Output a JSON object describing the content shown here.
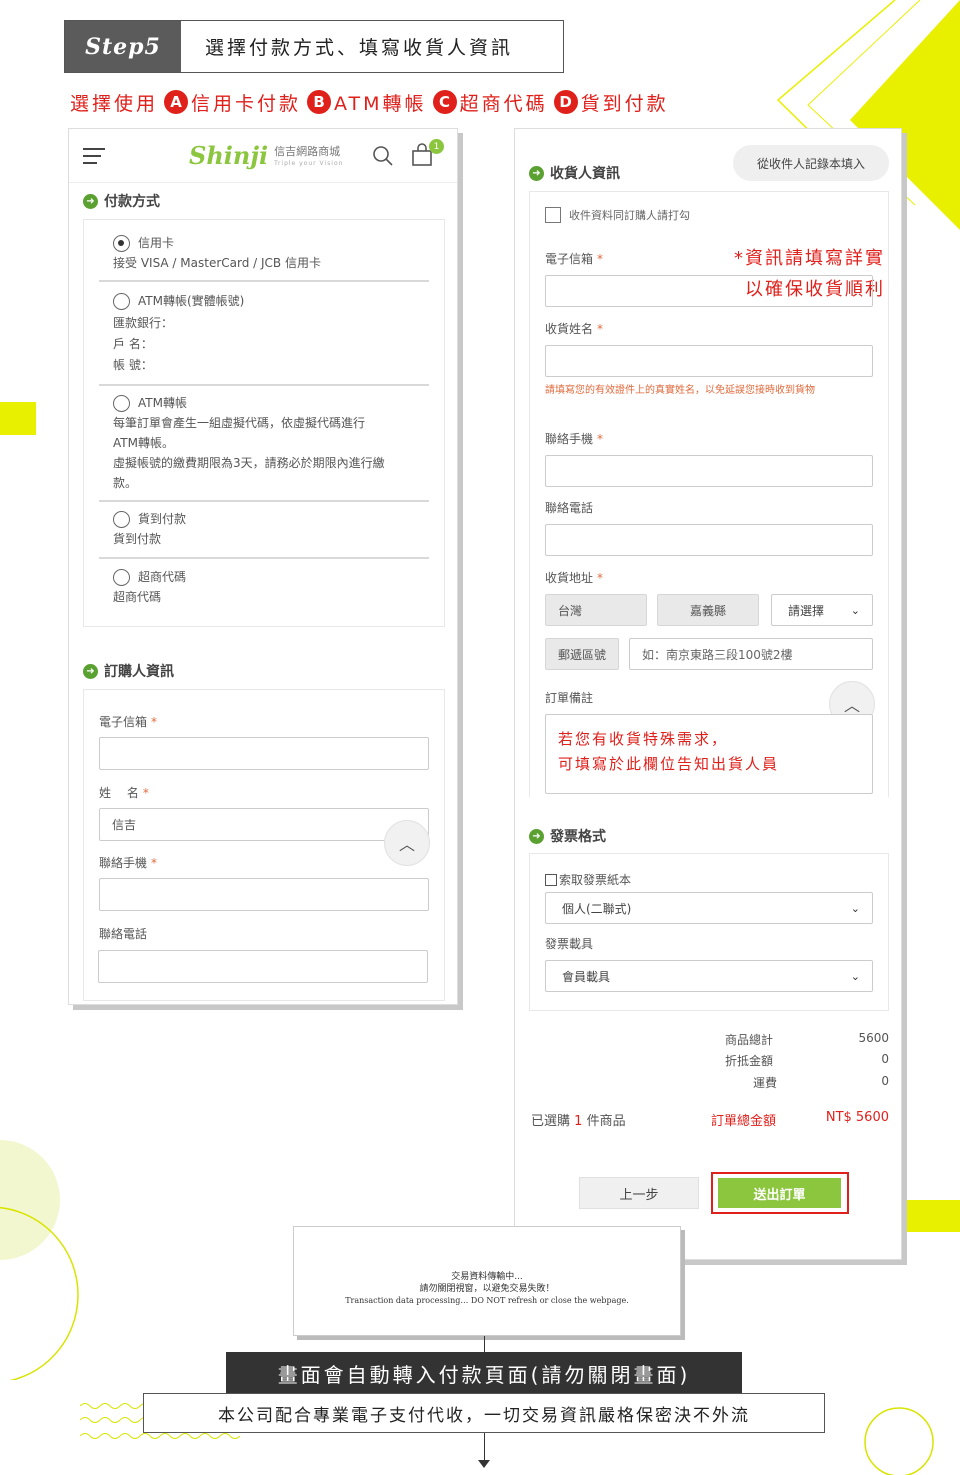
{
  "step": {
    "tag": "Step5",
    "title": "選擇付款方式、填寫收貨人資訊"
  },
  "choose": {
    "prefix": "選擇使用",
    "options": [
      {
        "badge": "A",
        "label": "信用卡付款"
      },
      {
        "badge": "B",
        "label": "ATM轉帳"
      },
      {
        "badge": "C",
        "label": "超商代碼"
      },
      {
        "badge": "D",
        "label": "貨到付款"
      }
    ]
  },
  "left": {
    "header": {
      "logo": "Shinji",
      "logo_cn": "信吉網路商城",
      "logo_sub": "Triple your Vision",
      "cart_count": "1"
    },
    "payment": {
      "title": "付款方式",
      "items": [
        {
          "name": "信用卡",
          "desc": "接受 VISA / MasterCard / JCB 信用卡"
        },
        {
          "name": "ATM轉帳(實體帳號)",
          "lines": [
            "匯款銀行：",
            "戶 名：",
            "帳 號："
          ]
        },
        {
          "name": "ATM轉帳",
          "lines": [
            "每筆訂單會產生一組虛擬代碼，依虛擬代碼進行",
            "ATM轉帳。",
            "虛擬帳號的繳費期限為3天，請務必於期限內進行繳",
            "款。"
          ]
        },
        {
          "name": "貨到付款",
          "desc": "貨到付款"
        },
        {
          "name": "超商代碼",
          "desc": "超商代碼"
        }
      ]
    },
    "buyer": {
      "title": "訂購人資訊",
      "email_label": "電子信箱",
      "name_label": "姓　 名",
      "name_value": "信吉",
      "mobile_label": "聯絡手機",
      "phone_label": "聯絡電話",
      "req": "*"
    }
  },
  "right": {
    "receiver": {
      "title": "收貨人資訊",
      "fill_button": "從收件人記錄本填入",
      "same_checkbox": "收件資料同訂購人請打勾",
      "email_label": "電子信箱",
      "note_red_1": "*資訊請填寫詳實",
      "note_red_2": "以確保收貨順利",
      "name_label": "收貨姓名",
      "name_hint": "請填寫您的有效證件上的真實姓名，以免延誤您接時收到貨物",
      "mobile_label": "聯絡手機",
      "phone_label": "聯絡電話",
      "address_label": "收貨地址",
      "country": "台灣",
      "county": "嘉義縣",
      "district_select": "請選擇",
      "zip": "郵遞區號",
      "address_placeholder": "如：南京東路三段100號2樓",
      "memo_label": "訂單備註",
      "memo_red_1": "若您有收貨特殊需求，",
      "memo_red_2": "可填寫於此欄位告知出貨人員",
      "req": "*"
    },
    "invoice": {
      "title": "發票格式",
      "paper_checkbox": "索取發票紙本",
      "type_select": "個人(二聯式)",
      "carrier_label": "發票載具",
      "carrier_select": "會員載具"
    },
    "summary": {
      "rows": [
        {
          "label": "商品總計",
          "value": "5600"
        },
        {
          "label": "折抵金額",
          "value": "0"
        },
        {
          "label": "運費",
          "value": "0"
        }
      ],
      "selected_prefix": "已選購",
      "selected_count": "1",
      "selected_suffix": "件商品",
      "total_label": "訂單總金額",
      "total_value": "NT$ 5600"
    },
    "buttons": {
      "prev": "上一步",
      "submit": "送出訂單"
    }
  },
  "processing": {
    "line1": "交易資料傳輸中...",
    "line2": "請勿關閉視窗，以避免交易失敗！",
    "line3": "Transaction data processing… DO NOT refresh or close the webpage."
  },
  "bottom": {
    "banner": "畫面會自動轉入付款頁面(請勿關閉畫面)",
    "notice": "本公司配合專業電子支付代收，一切交易資訊嚴格保密決不外流"
  },
  "colors": {
    "accent_red": "#e0201b",
    "yellow": "#e8f000",
    "green": "#8cc63f",
    "icon_green": "#5aa132"
  }
}
